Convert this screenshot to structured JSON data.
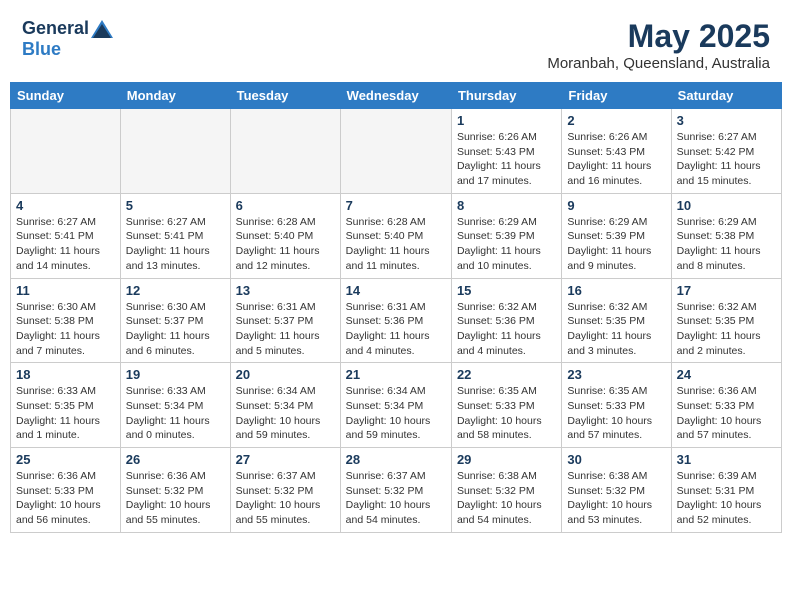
{
  "header": {
    "logo_general": "General",
    "logo_blue": "Blue",
    "month_year": "May 2025",
    "location": "Moranbah, Queensland, Australia"
  },
  "weekdays": [
    "Sunday",
    "Monday",
    "Tuesday",
    "Wednesday",
    "Thursday",
    "Friday",
    "Saturday"
  ],
  "weeks": [
    [
      {
        "day": "",
        "info": ""
      },
      {
        "day": "",
        "info": ""
      },
      {
        "day": "",
        "info": ""
      },
      {
        "day": "",
        "info": ""
      },
      {
        "day": "1",
        "info": "Sunrise: 6:26 AM\nSunset: 5:43 PM\nDaylight: 11 hours\nand 17 minutes."
      },
      {
        "day": "2",
        "info": "Sunrise: 6:26 AM\nSunset: 5:43 PM\nDaylight: 11 hours\nand 16 minutes."
      },
      {
        "day": "3",
        "info": "Sunrise: 6:27 AM\nSunset: 5:42 PM\nDaylight: 11 hours\nand 15 minutes."
      }
    ],
    [
      {
        "day": "4",
        "info": "Sunrise: 6:27 AM\nSunset: 5:41 PM\nDaylight: 11 hours\nand 14 minutes."
      },
      {
        "day": "5",
        "info": "Sunrise: 6:27 AM\nSunset: 5:41 PM\nDaylight: 11 hours\nand 13 minutes."
      },
      {
        "day": "6",
        "info": "Sunrise: 6:28 AM\nSunset: 5:40 PM\nDaylight: 11 hours\nand 12 minutes."
      },
      {
        "day": "7",
        "info": "Sunrise: 6:28 AM\nSunset: 5:40 PM\nDaylight: 11 hours\nand 11 minutes."
      },
      {
        "day": "8",
        "info": "Sunrise: 6:29 AM\nSunset: 5:39 PM\nDaylight: 11 hours\nand 10 minutes."
      },
      {
        "day": "9",
        "info": "Sunrise: 6:29 AM\nSunset: 5:39 PM\nDaylight: 11 hours\nand 9 minutes."
      },
      {
        "day": "10",
        "info": "Sunrise: 6:29 AM\nSunset: 5:38 PM\nDaylight: 11 hours\nand 8 minutes."
      }
    ],
    [
      {
        "day": "11",
        "info": "Sunrise: 6:30 AM\nSunset: 5:38 PM\nDaylight: 11 hours\nand 7 minutes."
      },
      {
        "day": "12",
        "info": "Sunrise: 6:30 AM\nSunset: 5:37 PM\nDaylight: 11 hours\nand 6 minutes."
      },
      {
        "day": "13",
        "info": "Sunrise: 6:31 AM\nSunset: 5:37 PM\nDaylight: 11 hours\nand 5 minutes."
      },
      {
        "day": "14",
        "info": "Sunrise: 6:31 AM\nSunset: 5:36 PM\nDaylight: 11 hours\nand 4 minutes."
      },
      {
        "day": "15",
        "info": "Sunrise: 6:32 AM\nSunset: 5:36 PM\nDaylight: 11 hours\nand 4 minutes."
      },
      {
        "day": "16",
        "info": "Sunrise: 6:32 AM\nSunset: 5:35 PM\nDaylight: 11 hours\nand 3 minutes."
      },
      {
        "day": "17",
        "info": "Sunrise: 6:32 AM\nSunset: 5:35 PM\nDaylight: 11 hours\nand 2 minutes."
      }
    ],
    [
      {
        "day": "18",
        "info": "Sunrise: 6:33 AM\nSunset: 5:35 PM\nDaylight: 11 hours\nand 1 minute."
      },
      {
        "day": "19",
        "info": "Sunrise: 6:33 AM\nSunset: 5:34 PM\nDaylight: 11 hours\nand 0 minutes."
      },
      {
        "day": "20",
        "info": "Sunrise: 6:34 AM\nSunset: 5:34 PM\nDaylight: 10 hours\nand 59 minutes."
      },
      {
        "day": "21",
        "info": "Sunrise: 6:34 AM\nSunset: 5:34 PM\nDaylight: 10 hours\nand 59 minutes."
      },
      {
        "day": "22",
        "info": "Sunrise: 6:35 AM\nSunset: 5:33 PM\nDaylight: 10 hours\nand 58 minutes."
      },
      {
        "day": "23",
        "info": "Sunrise: 6:35 AM\nSunset: 5:33 PM\nDaylight: 10 hours\nand 57 minutes."
      },
      {
        "day": "24",
        "info": "Sunrise: 6:36 AM\nSunset: 5:33 PM\nDaylight: 10 hours\nand 57 minutes."
      }
    ],
    [
      {
        "day": "25",
        "info": "Sunrise: 6:36 AM\nSunset: 5:33 PM\nDaylight: 10 hours\nand 56 minutes."
      },
      {
        "day": "26",
        "info": "Sunrise: 6:36 AM\nSunset: 5:32 PM\nDaylight: 10 hours\nand 55 minutes."
      },
      {
        "day": "27",
        "info": "Sunrise: 6:37 AM\nSunset: 5:32 PM\nDaylight: 10 hours\nand 55 minutes."
      },
      {
        "day": "28",
        "info": "Sunrise: 6:37 AM\nSunset: 5:32 PM\nDaylight: 10 hours\nand 54 minutes."
      },
      {
        "day": "29",
        "info": "Sunrise: 6:38 AM\nSunset: 5:32 PM\nDaylight: 10 hours\nand 54 minutes."
      },
      {
        "day": "30",
        "info": "Sunrise: 6:38 AM\nSunset: 5:32 PM\nDaylight: 10 hours\nand 53 minutes."
      },
      {
        "day": "31",
        "info": "Sunrise: 6:39 AM\nSunset: 5:31 PM\nDaylight: 10 hours\nand 52 minutes."
      }
    ]
  ]
}
